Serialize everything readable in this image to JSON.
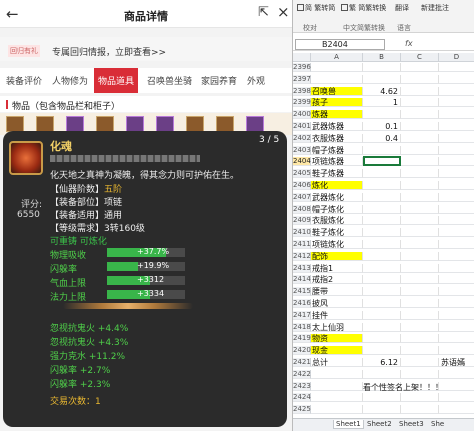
{
  "app": {
    "title": "商品详情",
    "back_icon": "arrow-left-icon",
    "share_icon": "share-icon",
    "close_icon": "close-icon"
  },
  "info": {
    "tag": "回归有礼",
    "link": "专属回归情报，立即查看>>"
  },
  "tabs": [
    "装备评价",
    "人物修为",
    "物品道具",
    "召唤兽坐骑",
    "家园养育",
    "外观"
  ],
  "active_tab_index": 2,
  "items_header": "物品（包含物品栏和柜子）",
  "popup": {
    "page_counter": "3 / 5",
    "score_label": "评分:",
    "score_value": "6550",
    "item_name": "化魂",
    "description": "化天地之真神为凝魄，得其念力则可护佑在生。",
    "attributes": [
      {
        "label": "【仙器阶数】",
        "value": "五阶"
      },
      {
        "label": "【装备部位】",
        "value": "项链"
      },
      {
        "label": "【装备适用】",
        "value": "通用"
      },
      {
        "label": "【等级需求】",
        "value": "3转160级"
      }
    ],
    "tradeable": "可重铸 可炼化",
    "stats": [
      {
        "label": "物理吸收",
        "text": "+37.7%",
        "fill": 0.75
      },
      {
        "label": "闪躲率",
        "text": "+19.9%",
        "fill": 0.4
      },
      {
        "label": "气血上限",
        "text": "+3312",
        "fill": 0.55
      },
      {
        "label": "法力上限",
        "text": "+3334",
        "fill": 0.55
      }
    ],
    "bonuses": [
      "忽视抗鬼火 +4.4%",
      "忽视抗鬼火 +4.3%",
      "强力克水 +11.2%",
      "闪躲率 +2.7%",
      "闪躲率 +2.3%"
    ],
    "trade_count": "交易次数：1"
  },
  "spreadsheet": {
    "ribbon_buttons": [
      "简 繁转简",
      "繁 简繁转换",
      "翻译",
      "新建批注"
    ],
    "ribbon_groups": [
      "校对",
      "中文简繁转换",
      "语言"
    ],
    "namebox": "B2404",
    "fx": "fx",
    "columns": [
      "A",
      "B",
      "C",
      "D"
    ],
    "rows": [
      {
        "n": "2396",
        "a": "",
        "b": "",
        "ya": false
      },
      {
        "n": "2397",
        "a": "",
        "b": "",
        "ya": false
      },
      {
        "n": "2398",
        "a": "召唤兽",
        "b": "4.62",
        "ya": true
      },
      {
        "n": "2399",
        "a": "孩子",
        "b": "1",
        "ya": true
      },
      {
        "n": "2400",
        "a": "炼器",
        "b": "",
        "ya": true
      },
      {
        "n": "2401",
        "a": "武器炼器",
        "b": "0.1",
        "ya": false
      },
      {
        "n": "2402",
        "a": "衣服炼器",
        "b": "0.4",
        "ya": false
      },
      {
        "n": "2403",
        "a": "帽子炼器",
        "b": "",
        "ya": false
      },
      {
        "n": "2404",
        "a": "项链炼器",
        "b": "",
        "ya": false,
        "sel": true
      },
      {
        "n": "2405",
        "a": "鞋子炼器",
        "b": "",
        "ya": false
      },
      {
        "n": "2406",
        "a": "炼化",
        "b": "",
        "ya": true
      },
      {
        "n": "2407",
        "a": "武器炼化",
        "b": "",
        "ya": false
      },
      {
        "n": "2408",
        "a": "帽子炼化",
        "b": "",
        "ya": false
      },
      {
        "n": "2409",
        "a": "衣服炼化",
        "b": "",
        "ya": false
      },
      {
        "n": "2410",
        "a": "鞋子炼化",
        "b": "",
        "ya": false
      },
      {
        "n": "2411",
        "a": "项链炼化",
        "b": "",
        "ya": false
      },
      {
        "n": "2412",
        "a": "配饰",
        "b": "",
        "ya": true
      },
      {
        "n": "2413",
        "a": "戒指1",
        "b": "",
        "ya": false
      },
      {
        "n": "2414",
        "a": "戒指2",
        "b": "",
        "ya": false
      },
      {
        "n": "2415",
        "a": "腰带",
        "b": "",
        "ya": false
      },
      {
        "n": "2416",
        "a": "披风",
        "b": "",
        "ya": false
      },
      {
        "n": "2417",
        "a": "挂件",
        "b": "",
        "ya": false
      },
      {
        "n": "2418",
        "a": "太上仙羽",
        "b": "",
        "ya": false
      },
      {
        "n": "2419",
        "a": "物资",
        "b": "",
        "ya": true
      },
      {
        "n": "2420",
        "a": "现金",
        "b": "",
        "ya": true
      },
      {
        "n": "2421",
        "a": "总计",
        "b": "6.12",
        "ya": false,
        "d": "苏语嫣"
      },
      {
        "n": "2422",
        "a": "",
        "b": "",
        "ya": false
      },
      {
        "n": "2423",
        "a": "",
        "b": "",
        "ya": false,
        "note": "看个性签名上架！！！"
      },
      {
        "n": "2424",
        "a": "",
        "b": "",
        "ya": false
      },
      {
        "n": "2425",
        "a": "",
        "b": "",
        "ya": false
      }
    ],
    "sheet_tabs": [
      "Sheet1",
      "Sheet2",
      "Sheet3",
      "She"
    ]
  }
}
